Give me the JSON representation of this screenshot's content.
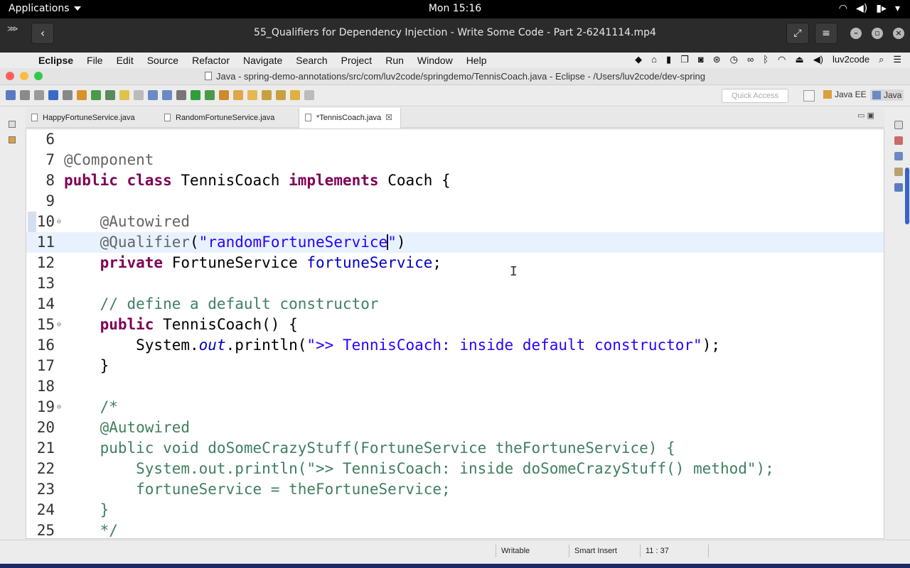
{
  "gnome": {
    "applications_label": "Applications",
    "clock": "Mon 15:16",
    "tray_icons": [
      "wifi-icon",
      "volume-icon",
      "battery-icon",
      "power-menu-icon"
    ]
  },
  "player": {
    "title": "55_Qualifiers for Dependency Injection - Write Some Code - Part 2-6241114.mp4",
    "back_glyph": "‹",
    "fullscreen_glyph": "⤢",
    "menu_glyph": "≡"
  },
  "mac_menu": {
    "app_name": "Eclipse",
    "menus": [
      "File",
      "Edit",
      "Source",
      "Refactor",
      "Navigate",
      "Search",
      "Project",
      "Run",
      "Window",
      "Help"
    ],
    "user": "luv2code"
  },
  "eclipse": {
    "window_title": "Java - spring-demo-annotations/src/com/luv2code/springdemo/TennisCoach.java - Eclipse - /Users/luv2code/dev-spring",
    "quick_access_placeholder": "Quick Access",
    "perspectives": [
      "Java EE",
      "Java"
    ],
    "tabs": [
      {
        "label": "HappyFortuneService.java",
        "active": false
      },
      {
        "label": "RandomFortuneService.java",
        "active": false
      },
      {
        "label": "*TennisCoach.java",
        "active": true
      }
    ],
    "status": {
      "writable": "Writable",
      "insert_mode": "Smart Insert",
      "position": "11 : 37"
    }
  },
  "editor": {
    "current_line": 11,
    "lines": [
      {
        "n": "6",
        "text": ""
      },
      {
        "n": "7",
        "text": "@Component"
      },
      {
        "n": "8",
        "text": "public class TennisCoach implements Coach {"
      },
      {
        "n": "9",
        "text": ""
      },
      {
        "n": "10",
        "text": "    @Autowired"
      },
      {
        "n": "11",
        "text": "    @Qualifier(\"randomFortuneService\")"
      },
      {
        "n": "12",
        "text": "    private FortuneService fortuneService;"
      },
      {
        "n": "13",
        "text": ""
      },
      {
        "n": "14",
        "text": "    // define a default constructor"
      },
      {
        "n": "15",
        "text": "    public TennisCoach() {"
      },
      {
        "n": "16",
        "text": "        System.out.println(\">> TennisCoach: inside default constructor\");"
      },
      {
        "n": "17",
        "text": "    }"
      },
      {
        "n": "18",
        "text": ""
      },
      {
        "n": "19",
        "text": "    /*"
      },
      {
        "n": "20",
        "text": "    @Autowired"
      },
      {
        "n": "21",
        "text": "    public void doSomeCrazyStuff(FortuneService theFortuneService) {"
      },
      {
        "n": "22",
        "text": "        System.out.println(\">> TennisCoach: inside doSomeCrazyStuff() method\");"
      },
      {
        "n": "23",
        "text": "        fortuneService = theFortuneService;"
      },
      {
        "n": "24",
        "text": "    }"
      },
      {
        "n": "25",
        "text": "    */"
      }
    ]
  }
}
